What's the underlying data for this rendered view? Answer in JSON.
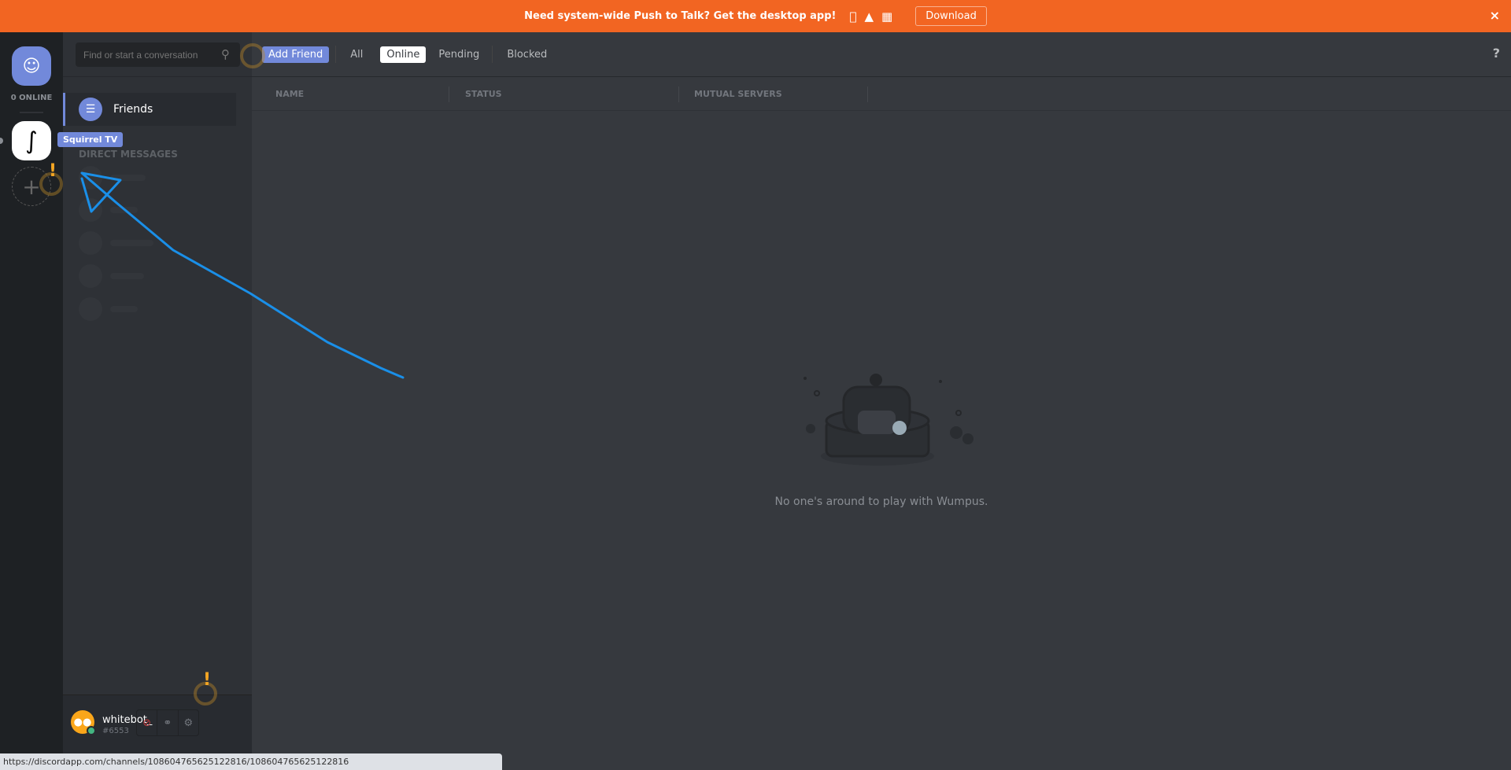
{
  "banner": {
    "message": "Need system-wide Push to Talk? Get the desktop app!",
    "os_icons": [
      "apple-icon",
      "android-icon",
      "windows-icon"
    ],
    "download_label": "Download",
    "close": "×",
    "color": "#f26522"
  },
  "rail": {
    "online_count": "0 ONLINE",
    "server_name": "Squirrel TV",
    "add_server": "+"
  },
  "sidebar": {
    "search_placeholder": "Find or start a conversation",
    "friends_label": "Friends",
    "dm_header": "DIRECT MESSAGES"
  },
  "header": {
    "tabs": [
      "Add Friend",
      "All",
      "Online",
      "Pending",
      "Blocked"
    ],
    "active_tab": "Online",
    "help": "?"
  },
  "table": {
    "columns": [
      "NAME",
      "STATUS",
      "MUTUAL SERVERS"
    ]
  },
  "empty_state": "No one's around to play with Wumpus.",
  "user": {
    "name": "whitebot_",
    "discriminator": "#6553",
    "status_color": "#43b581"
  },
  "status_url": "https://discordapp.com/channels/108604765625122816/108604765625122816",
  "accent": "#7289da"
}
